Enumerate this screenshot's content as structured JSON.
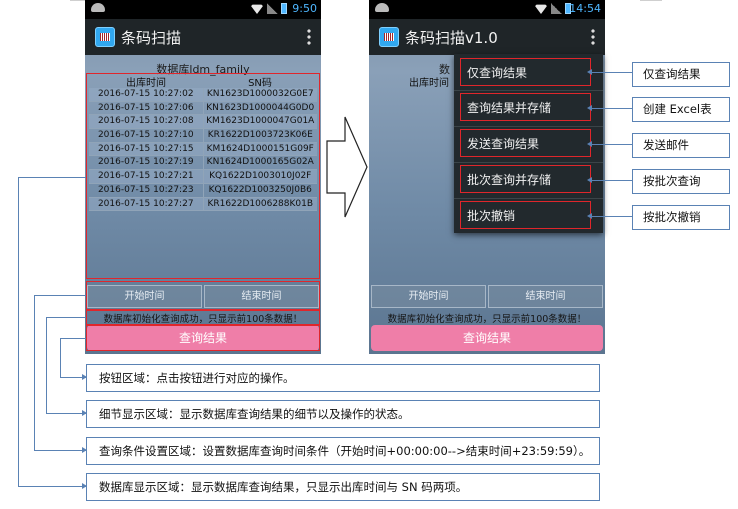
{
  "left_phone": {
    "status_time": "9:50",
    "app_title": "条码扫描",
    "db_title": "数据库ldm_family",
    "columns": [
      "出库时间",
      "SN码"
    ],
    "rows": [
      [
        "2016-07-15 10:27:02",
        "KN1623D1000032G0E7"
      ],
      [
        "2016-07-15 10:27:06",
        "KN1623D1000044G0D0"
      ],
      [
        "2016-07-15 10:27:08",
        "KM1623D1000047G01A"
      ],
      [
        "2016-07-15 10:27:10",
        "KR1622D1003723K06E"
      ],
      [
        "2016-07-15 10:27:15",
        "KM1624D1000151G09F"
      ],
      [
        "2016-07-15 10:27:19",
        "KN1624D1000165G02A"
      ],
      [
        "2016-07-15 10:27:21",
        "KQ1622D1003010J02F"
      ],
      [
        "2016-07-15 10:27:23",
        "KQ1622D1003250J0B6"
      ],
      [
        "2016-07-15 10:27:27",
        "KR1622D1006288K01B"
      ]
    ],
    "start_time_label": "开始时间",
    "end_time_label": "结束时间",
    "detail_text": "数据库初始化查询成功，只显示前100条数据！",
    "query_label": "查询结果"
  },
  "right_phone": {
    "status_time": "14:54",
    "app_title": "条码扫描v1.0",
    "db_title_partial": "数",
    "col_partial": "出库时间",
    "start_time_label": "开始时间",
    "end_time_label": "结束时间",
    "detail_text": "数据库初始化查询成功，只显示前100条数据！",
    "query_label": "查询结果",
    "menu": [
      "仅查询结果",
      "查询结果并存储",
      "发送查询结果",
      "批次查询并存储",
      "批次撤销"
    ]
  },
  "callouts": [
    "仅查询结果",
    "创建 Excel表",
    "发送邮件",
    "按批次查询",
    "按批次撤销"
  ],
  "descriptions": [
    "按钮区域：点击按钮进行对应的操作。",
    "细节显示区域：显示数据库查询结果的细节以及操作的状态。",
    "查询条件设置区域：设置数据库查询时间条件（开始时间+00:00:00-->结束时间+23:59:59）。",
    "数据库显示区域：显示数据库查询结果，只显示出库时间与 SN 码两项。"
  ],
  "colors": {
    "highlight": "#e0262b",
    "connector": "#5a82b4",
    "query_button": "#ef7ea8"
  }
}
